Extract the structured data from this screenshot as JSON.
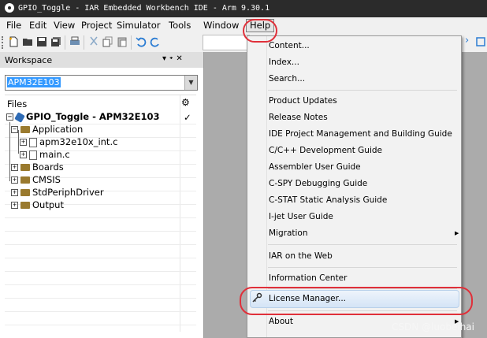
{
  "window": {
    "title": "GPIO_Toggle - IAR Embedded Workbench IDE - Arm 9.30.1"
  },
  "menubar": {
    "items": [
      "File",
      "Edit",
      "View",
      "Project",
      "Simulator",
      "Tools",
      "Window",
      "Help"
    ]
  },
  "workspace": {
    "title": "Workspace",
    "pin_label": "▾ ᛭ ✕",
    "config_value": "APM32E103",
    "files_header": "Files",
    "project_name": "GPIO_Toggle - APM32E103",
    "project_check": "✓",
    "tree": [
      {
        "label": "Application",
        "type": "folder",
        "expander": "−"
      },
      {
        "label": "apm32e10x_int.c",
        "type": "file",
        "expander": "+"
      },
      {
        "label": "main.c",
        "type": "file",
        "expander": "+"
      },
      {
        "label": "Boards",
        "type": "folder",
        "expander": "+"
      },
      {
        "label": "CMSIS",
        "type": "folder",
        "expander": "+"
      },
      {
        "label": "StdPeriphDriver",
        "type": "folder",
        "expander": "+"
      },
      {
        "label": "Output",
        "type": "folder",
        "expander": "+"
      }
    ]
  },
  "help_menu": {
    "items": [
      "Content...",
      "Index...",
      "Search...",
      "Product Updates",
      "Release Notes",
      "IDE Project Management and Building Guide",
      "C/C++ Development Guide",
      "Assembler User Guide",
      "C-SPY Debugging Guide",
      "C-STAT Static Analysis Guide",
      "I-jet User Guide",
      "Migration",
      "IAR on the Web",
      "Information Center",
      "License Manager...",
      "About"
    ],
    "highlighted": "License Manager..."
  },
  "watermark": "CSDN @luobeihai",
  "colors": {
    "annotation": "#e0303a",
    "selection": "#3399ff",
    "titlebar": "#2b2b2b"
  }
}
